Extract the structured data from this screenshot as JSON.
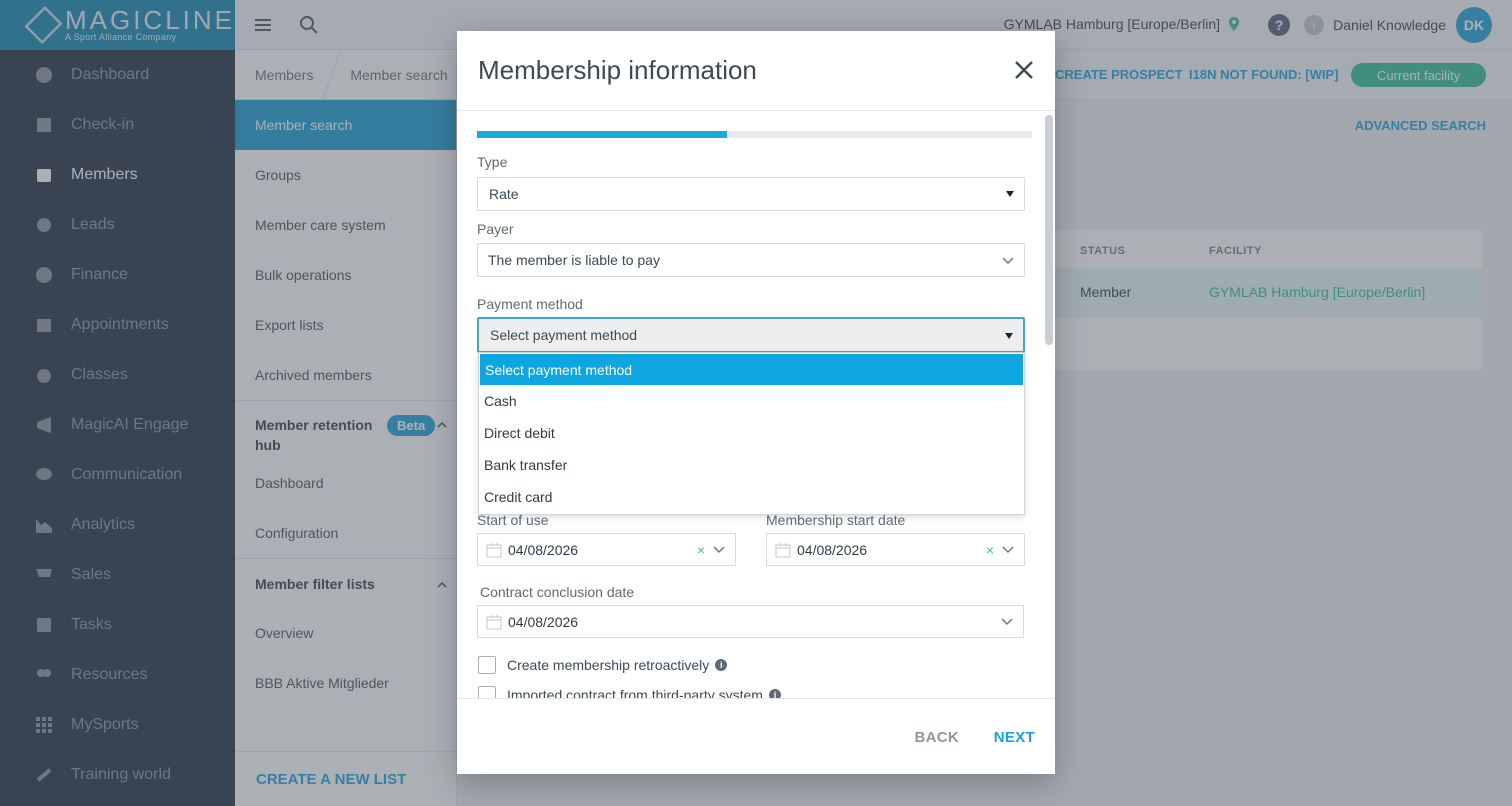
{
  "brand": {
    "name": "MAGICLINE",
    "tagline": "A Sport Alliance Company"
  },
  "sidebar": {
    "items": [
      {
        "label": "Dashboard",
        "icon": "dashboard-icon"
      },
      {
        "label": "Check-in",
        "icon": "checkin-icon"
      },
      {
        "label": "Members",
        "icon": "members-icon",
        "active": true
      },
      {
        "label": "Leads",
        "icon": "leads-icon"
      },
      {
        "label": "Finance",
        "icon": "finance-icon"
      },
      {
        "label": "Appointments",
        "icon": "calendar-icon"
      },
      {
        "label": "Classes",
        "icon": "classes-icon"
      },
      {
        "label": "MagicAI Engage",
        "icon": "megaphone-icon"
      },
      {
        "label": "Communication",
        "icon": "chat-icon"
      },
      {
        "label": "Analytics",
        "icon": "chart-icon"
      },
      {
        "label": "Sales",
        "icon": "cart-icon"
      },
      {
        "label": "Tasks",
        "icon": "check-icon"
      },
      {
        "label": "Resources",
        "icon": "people-icon"
      },
      {
        "label": "MySports",
        "icon": "grid-icon"
      },
      {
        "label": "Training world",
        "icon": "dumbbell-icon"
      }
    ]
  },
  "header": {
    "facility": "GYMLAB Hamburg [Europe/Berlin]",
    "user_name": "Daniel Knowledge",
    "user_initials": "DK",
    "help_glyph": "?",
    "info_glyph": "i"
  },
  "subnav": {
    "breadcrumb": [
      "Members",
      "Member search"
    ],
    "items": [
      "Member search",
      "Groups",
      "Member care system",
      "Bulk operations",
      "Export lists",
      "Archived members"
    ],
    "retention_hub": {
      "title": "Member retention hub",
      "badge": "Beta",
      "items": [
        "Dashboard",
        "Configuration"
      ]
    },
    "filter_lists": {
      "title": "Member filter lists",
      "items": [
        "Overview",
        "BBB Aktive Mitglieder"
      ]
    },
    "create_list": "CREATE A NEW LIST"
  },
  "main": {
    "create_prospect": "CREATE PROSPECT",
    "i18n_link": "I18N NOT FOUND: [WIP]",
    "current_facility": "Current facility",
    "advanced_search": "ADVANCED SEARCH",
    "columns": {
      "status": "STATUS",
      "facility": "FACILITY"
    },
    "row": {
      "status": "Member",
      "facility": "GYMLAB Hamburg [Europe/Berlin]"
    }
  },
  "modal": {
    "title": "Membership information",
    "progress": 0.45,
    "type": {
      "label": "Type",
      "value": "Rate"
    },
    "payer": {
      "label": "Payer",
      "value": "The member is liable to pay"
    },
    "payment_method": {
      "label": "Payment method",
      "value": "Select payment method",
      "options": [
        "Select payment method",
        "Cash",
        "Direct debit",
        "Bank transfer",
        "Credit card"
      ]
    },
    "start_of_use": {
      "label": "Start of use",
      "value": "04/08/2026"
    },
    "membership_start": {
      "label": "Membership start date",
      "value": "04/08/2026"
    },
    "contract_conclusion": {
      "label": "Contract conclusion date",
      "value": "04/08/2026"
    },
    "clear_glyph": "×",
    "checkboxes": [
      "Create membership retroactively",
      "Imported contract from third-party system"
    ],
    "back": "BACK",
    "next": "NEXT"
  },
  "colors": {
    "accent": "#1ca6dd",
    "sidebar": "#2c3b49",
    "facility_green": "#3dbf9e"
  }
}
